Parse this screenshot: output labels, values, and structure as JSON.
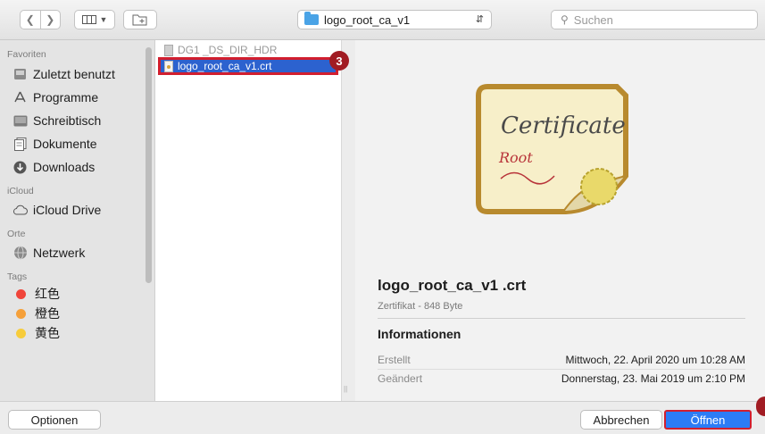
{
  "toolbar": {
    "path_label": "logo_root_ca_v1",
    "search_placeholder": "Suchen"
  },
  "sidebar": {
    "favorites_heading": "Favoriten",
    "favorites": [
      {
        "label": "Zuletzt benutzt",
        "icon": "recents-icon"
      },
      {
        "label": "Programme",
        "icon": "applications-icon"
      },
      {
        "label": "Schreibtisch",
        "icon": "desktop-icon"
      },
      {
        "label": "Dokumente",
        "icon": "documents-icon"
      },
      {
        "label": "Downloads",
        "icon": "downloads-icon"
      }
    ],
    "icloud_heading": "iCloud",
    "icloud_items": [
      {
        "label": "iCloud Drive",
        "icon": "cloud-icon"
      }
    ],
    "places_heading": "Orte",
    "places": [
      {
        "label": "Netzwerk",
        "icon": "network-icon"
      }
    ],
    "tags_heading": "Tags",
    "tags": [
      {
        "label": "红色",
        "color": "#f0453a"
      },
      {
        "label": "橙色",
        "color": "#f5a03a"
      },
      {
        "label": "黄色",
        "color": "#f7cc3b"
      }
    ]
  },
  "files": {
    "items": [
      {
        "name": "DG1 _DS_DIR_HDR",
        "state": "faded"
      },
      {
        "name": "logo_root_ca_v1.crt",
        "state": "selected"
      }
    ],
    "callout_number": "3"
  },
  "preview": {
    "cert_title": "Certificate",
    "cert_subtitle": "Root",
    "filename": "logo_root_ca_v1 .crt",
    "kind": "Zertifikat - 848 Byte",
    "info_heading": "Informationen",
    "created_label": "Erstellt",
    "created_value": "Mittwoch, 22. April 2020 um 10:28 AM",
    "modified_label": "Geändert",
    "modified_value": "Donnerstag, 23. Mai 2019 um 2:10 PM"
  },
  "buttons": {
    "options": "Optionen",
    "cancel": "Abbrechen",
    "open": "Öffnen"
  }
}
